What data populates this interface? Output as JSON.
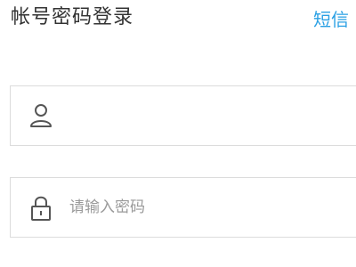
{
  "header": {
    "title": "帐号密码登录",
    "switch_link": "短信"
  },
  "form": {
    "account": {
      "value": "",
      "placeholder": "",
      "icon": "user-icon"
    },
    "password": {
      "value": "",
      "placeholder": "请输入密码",
      "icon": "lock-icon"
    }
  },
  "colors": {
    "accent": "#2aa0e4",
    "border": "#dcdcdc",
    "title_text": "#333333",
    "placeholder_text": "#9a9a9a"
  }
}
